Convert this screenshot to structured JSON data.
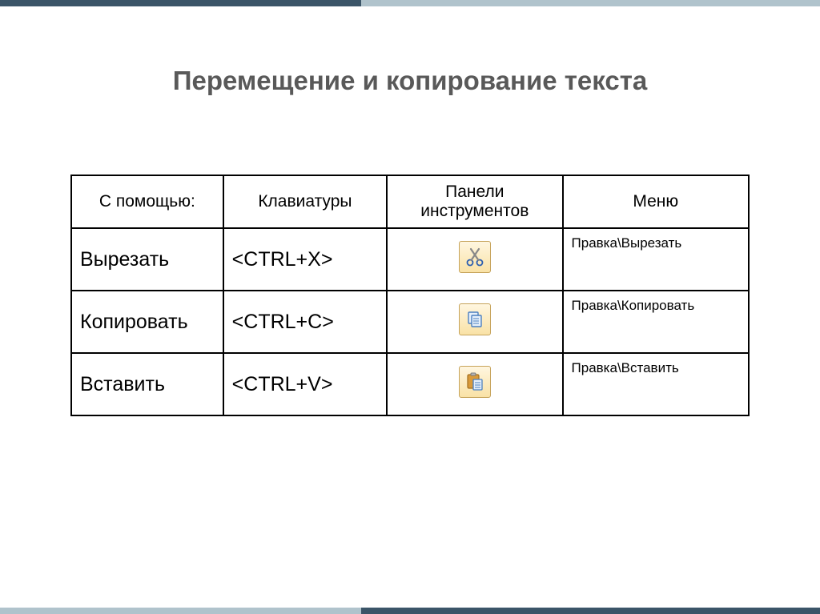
{
  "title": "Перемещение и копирование текста",
  "table": {
    "headers": {
      "with": "С помощью:",
      "keyboard": "Клавиатуры",
      "toolbar": "Панели инструментов",
      "menu": "Меню"
    },
    "rows": [
      {
        "action": "Вырезать",
        "keyboard": "<CTRL+X>",
        "icon": "cut-icon",
        "menu": "Правка\\Вырезать"
      },
      {
        "action": "Копировать",
        "keyboard": "<CTRL+C>",
        "icon": "copy-icon",
        "menu": "Правка\\Копировать"
      },
      {
        "action": "Вставить",
        "keyboard": "<CTRL+V>",
        "icon": "paste-icon",
        "menu": "Правка\\Вставить"
      }
    ]
  }
}
